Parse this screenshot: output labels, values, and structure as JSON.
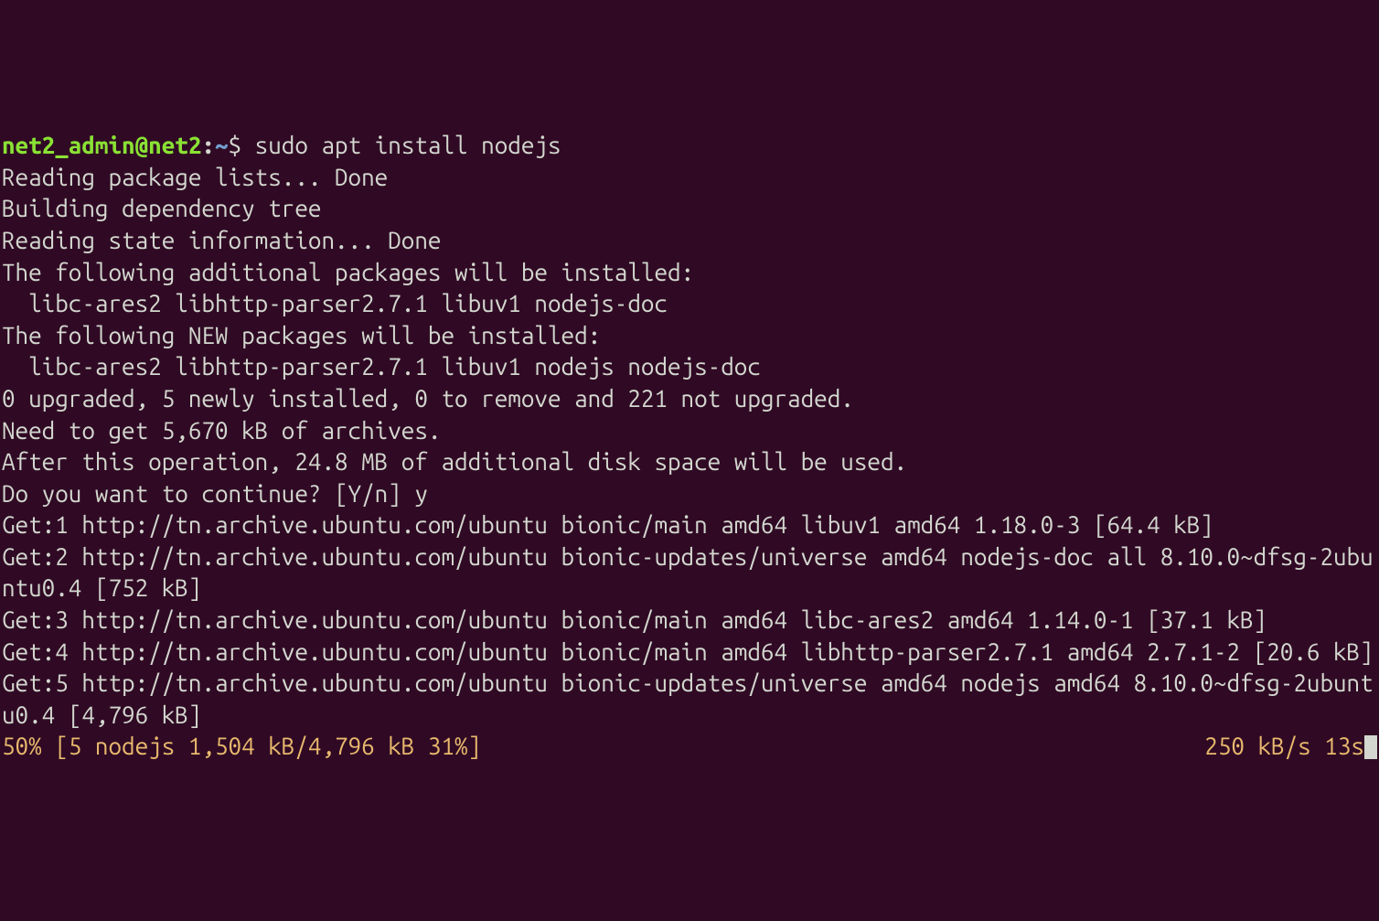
{
  "prompt": {
    "user_host": "net2_admin@net2",
    "separator": ":",
    "path": "~",
    "symbol": "$ "
  },
  "command": "sudo apt install nodejs",
  "output": {
    "line1": "Reading package lists... Done",
    "line2": "Building dependency tree",
    "line3": "Reading state information... Done",
    "line4": "The following additional packages will be installed:",
    "line5": "  libc-ares2 libhttp-parser2.7.1 libuv1 nodejs-doc",
    "line6": "The following NEW packages will be installed:",
    "line7": "  libc-ares2 libhttp-parser2.7.1 libuv1 nodejs nodejs-doc",
    "line8": "0 upgraded, 5 newly installed, 0 to remove and 221 not upgraded.",
    "line9": "Need to get 5,670 kB of archives.",
    "line10": "After this operation, 24.8 MB of additional disk space will be used.",
    "line11": "Do you want to continue? [Y/n] y",
    "line12": "Get:1 http://tn.archive.ubuntu.com/ubuntu bionic/main amd64 libuv1 amd64 1.18.0-3 [64.4 kB]",
    "line13": "Get:2 http://tn.archive.ubuntu.com/ubuntu bionic-updates/universe amd64 nodejs-doc all 8.10.0~dfsg-2ubuntu0.4 [752 kB]",
    "line14": "Get:3 http://tn.archive.ubuntu.com/ubuntu bionic/main amd64 libc-ares2 amd64 1.14.0-1 [37.1 kB]",
    "line15": "Get:4 http://tn.archive.ubuntu.com/ubuntu bionic/main amd64 libhttp-parser2.7.1 amd64 2.7.1-2 [20.6 kB]",
    "line16": "Get:5 http://tn.archive.ubuntu.com/ubuntu bionic-updates/universe amd64 nodejs amd64 8.10.0~dfsg-2ubuntu0.4 [4,796 kB]"
  },
  "progress": {
    "left": "50% [5 nodejs 1,504 kB/4,796 kB 31%]",
    "right": "250 kB/s 13s"
  },
  "colors": {
    "background": "#300a24",
    "text": "#d3d7cf",
    "prompt_green": "#8ae234",
    "prompt_blue": "#729fcf",
    "progress_orange": "#e9b96e"
  }
}
